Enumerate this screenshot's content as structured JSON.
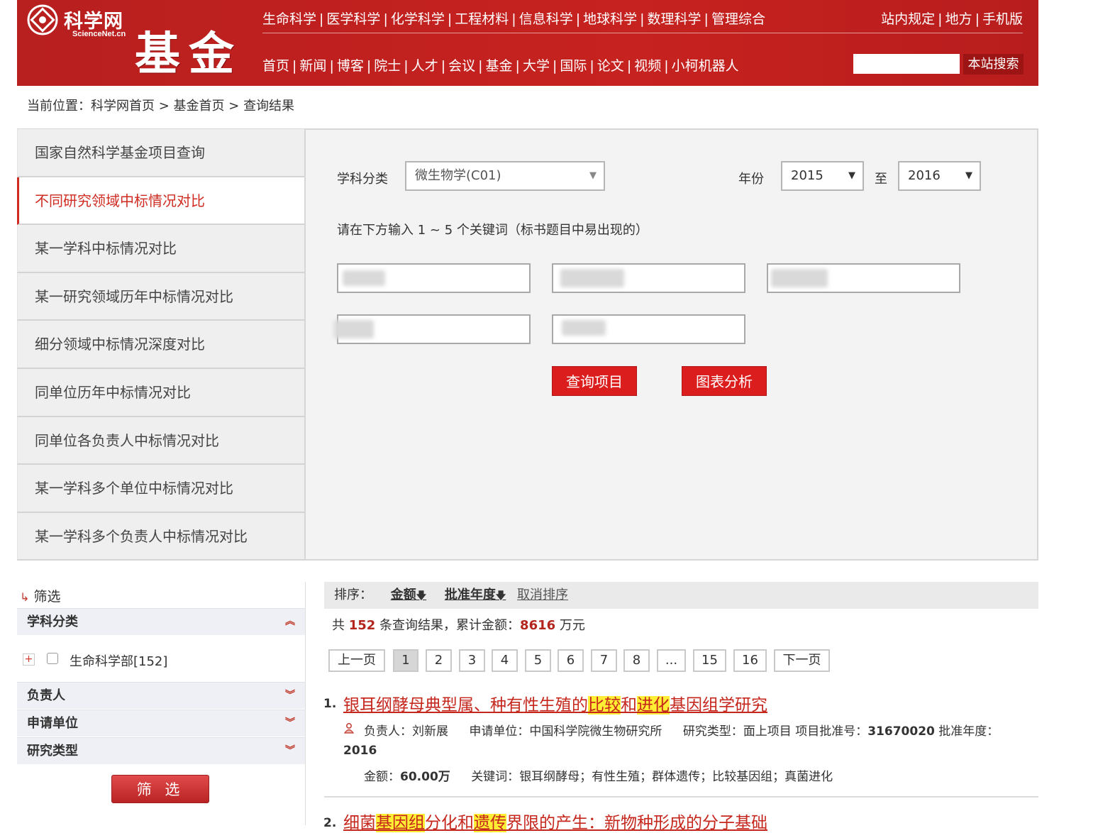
{
  "header": {
    "logo_cn": "科学网",
    "logo_en": "ScienceNet.cn",
    "brand": "基金",
    "top_nav": [
      "生命科学",
      "医学科学",
      "化学科学",
      "工程材料",
      "信息科学",
      "地球科学",
      "数理科学",
      "管理综合"
    ],
    "right_nav": [
      "站内规定",
      "地方",
      "手机版"
    ],
    "sub_nav": [
      "首页",
      "新闻",
      "博客",
      "院士",
      "人才",
      "会议",
      "基金",
      "大学",
      "国际",
      "论文",
      "视频",
      "小柯机器人"
    ],
    "search_placeholder": "",
    "search_button": "本站搜索"
  },
  "breadcrumb": {
    "prefix": "当前位置：",
    "items": [
      "科学网首页",
      "基金首页",
      "查询结果"
    ],
    "separator": " > "
  },
  "menu": {
    "items": [
      "国家自然科学基金项目查询",
      "不同研究领域中标情况对比",
      "某一学科中标情况对比",
      "某一研究领域历年中标情况对比",
      "细分领域中标情况深度对比",
      "同单位历年中标情况对比",
      "同单位各负责人中标情况对比",
      "某一学科多个单位中标情况对比",
      "某一学科多个负责人中标情况对比"
    ],
    "active_index": 1
  },
  "query": {
    "subject_label": "学科分类",
    "subject_value": "微生物学(C01)",
    "year_label": "年份",
    "year_from": "2015",
    "year_to_label": "至",
    "year_to": "2016",
    "keyword_hint": "请在下方输入 1 ~ 5 个关键词（标书题目中易出现的）",
    "search_button": "查询项目",
    "chart_button": "图表分析"
  },
  "filter": {
    "title": "筛选",
    "sections": [
      {
        "label": "学科分类",
        "expanded": true
      },
      {
        "label": "负责人",
        "expanded": false
      },
      {
        "label": "申请单位",
        "expanded": false
      },
      {
        "label": "研究类型",
        "expanded": false
      }
    ],
    "tree_item": "生命科学部[152]",
    "tree_plus": "+",
    "apply_button": "筛 选"
  },
  "results": {
    "sort_label": "排序：",
    "sort_amount": "金额",
    "sort_year": "批准年度",
    "sort_arrow": "🡇",
    "sort_cancel": "取消排序",
    "summary_a": "共 ",
    "total_count": "152",
    "summary_b": " 条查询结果，累计金额：",
    "total_amount": "8616",
    "summary_c": " 万元",
    "pagination": {
      "prev": "上一页",
      "pages": [
        "1",
        "2",
        "3",
        "4",
        "5",
        "6",
        "7",
        "8",
        "...",
        "15",
        "16"
      ],
      "current": "1",
      "next": "下一页"
    },
    "items": [
      {
        "index": "1.",
        "title_parts": [
          "银耳纲酵母典型属、种有性生殖的",
          "比较",
          "和",
          "进化",
          "基因组学研究"
        ],
        "leader_label": "负责人：",
        "leader": "刘新展",
        "org_label": "申请单位：",
        "org": "中国科学院微生物研究所",
        "type_label": "研究类型：",
        "type": "面上项目",
        "approval_label": "项目批准号：",
        "approval": "31670020",
        "year_label": "批准年度：",
        "year": "2016",
        "amount_label": "金额：",
        "amount": "60.00万",
        "keywords_label": "关键词：",
        "keywords": "银耳纲酵母；有性生殖；群体遗传；比较基因组；真菌进化"
      },
      {
        "index": "2.",
        "title_parts": [
          "细菌",
          "基因组",
          "分化和",
          "遗传",
          "界限的产生：新物种形成的分子基础"
        ]
      }
    ]
  },
  "colors": {
    "brand_red": "#c6221f",
    "active_menu": "#cf2b20",
    "button_red": "#dc1d1d",
    "highlight": "#ffee33"
  }
}
